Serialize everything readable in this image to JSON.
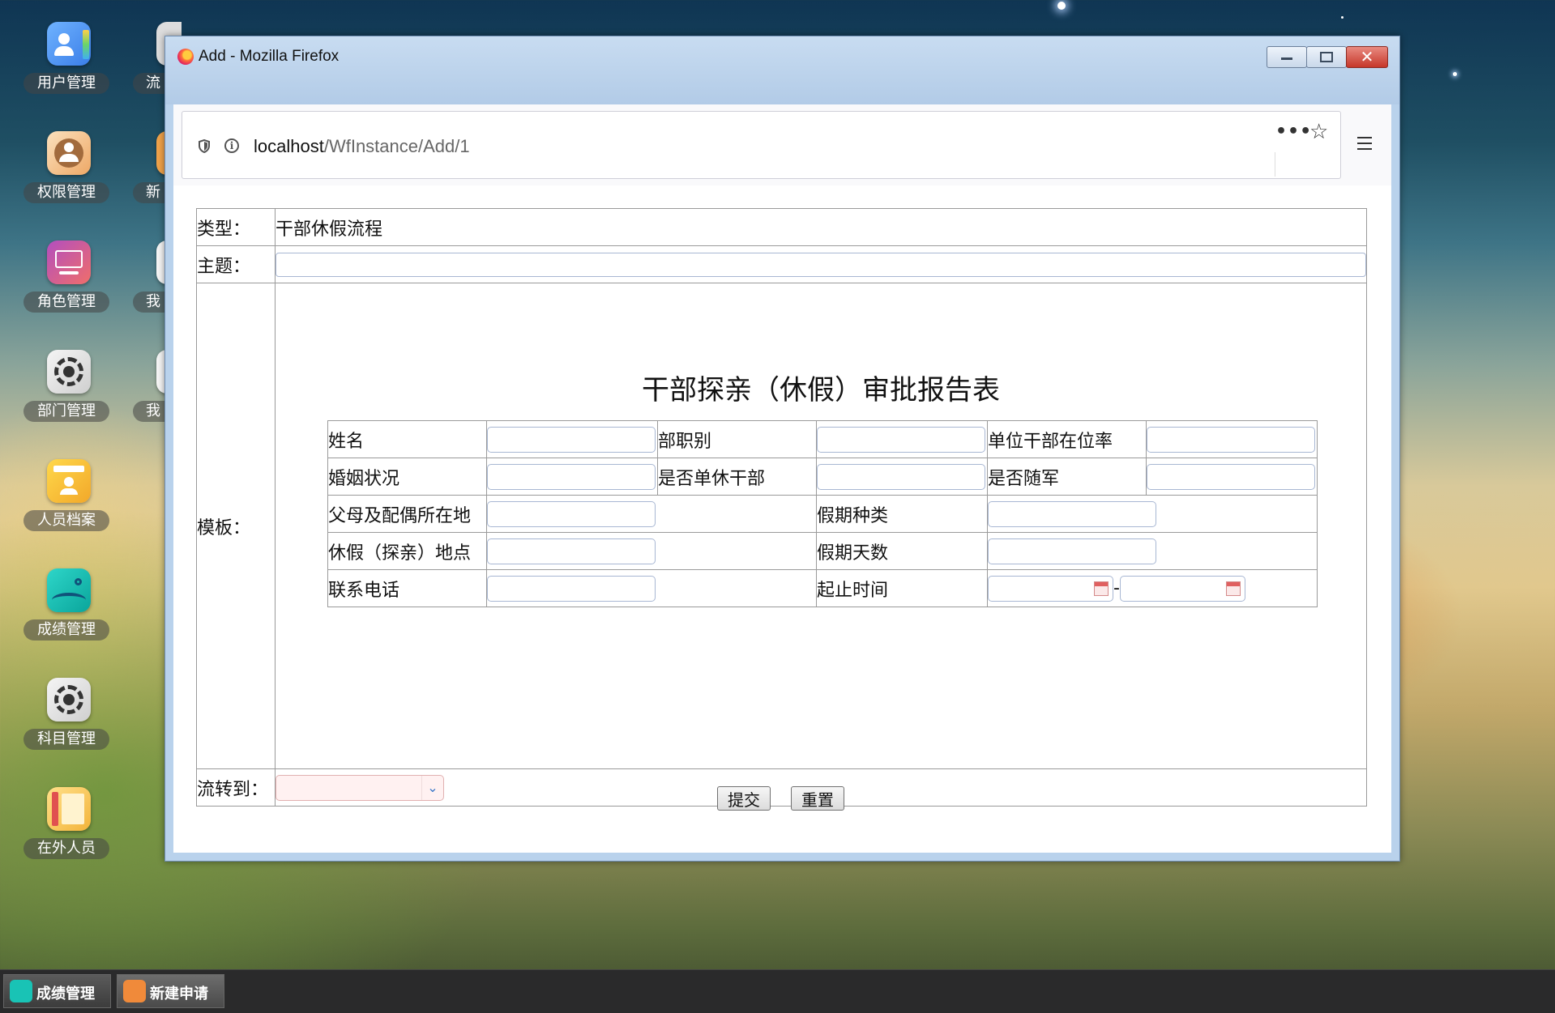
{
  "desktop": {
    "icons": [
      {
        "label": "用户管理",
        "icon": "user-card-icon",
        "color": "#4a8ef0"
      },
      {
        "label": "权限管理",
        "icon": "group-icon",
        "color": "#f1c08a"
      },
      {
        "label": "角色管理",
        "icon": "presentation-icon",
        "color": "#e05a7a"
      },
      {
        "label": "部门管理",
        "icon": "gear-icon",
        "color": "#555555"
      },
      {
        "label": "人员档案",
        "icon": "profile-icon",
        "color": "#f7c531"
      },
      {
        "label": "成绩管理",
        "icon": "wave-icon",
        "color": "#19c3b5"
      },
      {
        "label": "科目管理",
        "icon": "gear-icon",
        "color": "#555555"
      },
      {
        "label": "在外人员",
        "icon": "book-icon",
        "color": "#f5c65a"
      }
    ],
    "partial_icons": [
      {
        "label": "流"
      },
      {
        "label": "新"
      },
      {
        "label": "我"
      },
      {
        "label": "我"
      }
    ]
  },
  "window": {
    "title": "Add - Mozilla Firefox",
    "url_host": "localhost",
    "url_path": "/WfInstance/Add/1"
  },
  "form": {
    "type_label": "类型：",
    "type_value": "干部休假流程",
    "subject_label": "主题：",
    "template_label": "模板：",
    "flow_label": "流转到：",
    "submit_label": "提交",
    "reset_label": "重置"
  },
  "template": {
    "title": "干部探亲（休假）审批报告表",
    "name": "姓名",
    "dept_rank": "部职别",
    "unit_rate": "单位干部在位率",
    "marital": "婚姻状况",
    "single_retired": "是否单休干部",
    "with_army": "是否随军",
    "parents_location": "父母及配偶所在地",
    "vacation_type": "假期种类",
    "vacation_place": "休假（探亲）地点",
    "vacation_days": "假期天数",
    "phone": "联系电话",
    "period": "起止时间",
    "date_sep": "-"
  },
  "taskbar": {
    "items": [
      {
        "label": "成绩管理",
        "color": "#19c3b5"
      },
      {
        "label": "新建申请",
        "color": "#f08a3a"
      }
    ]
  }
}
